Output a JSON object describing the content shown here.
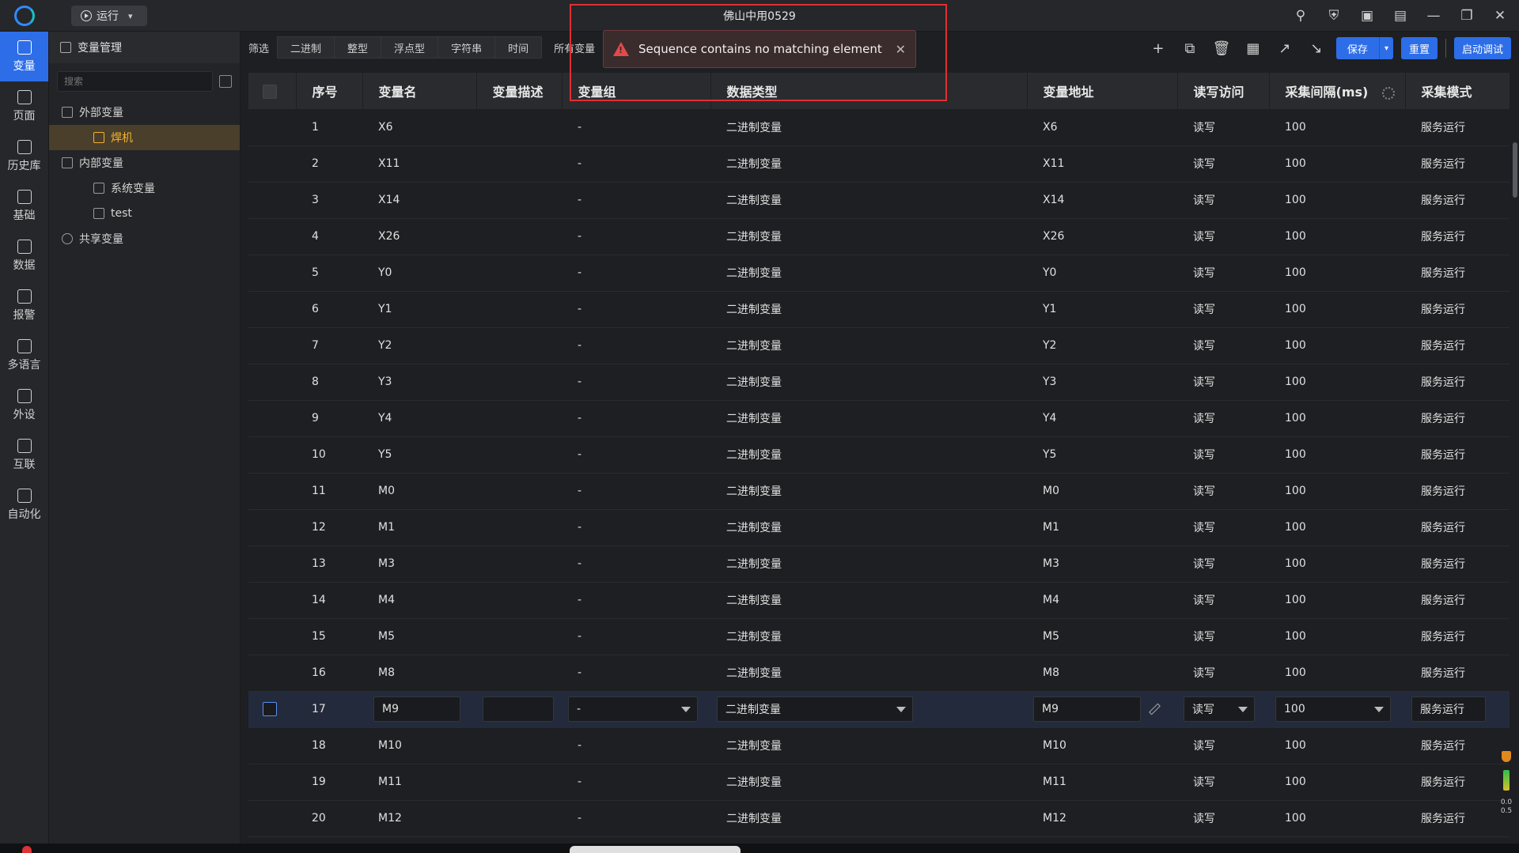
{
  "window": {
    "title": "佛山中用0529"
  },
  "topbar": {
    "run_label": "运行"
  },
  "rail": [
    {
      "label": "变量",
      "active": true
    },
    {
      "label": "页面"
    },
    {
      "label": "历史库"
    },
    {
      "label": "基础"
    },
    {
      "label": "数据"
    },
    {
      "label": "报警"
    },
    {
      "label": "多语言"
    },
    {
      "label": "外设"
    },
    {
      "label": "互联"
    },
    {
      "label": "自动化"
    }
  ],
  "tree": {
    "header": "变量管理",
    "search_placeholder": "搜索",
    "nodes": {
      "external": "外部变量",
      "welder": "焊机",
      "internal": "内部变量",
      "system": "系统变量",
      "test": "test",
      "shared": "共享变量"
    }
  },
  "filter": {
    "label": "筛选",
    "tabs": [
      "二进制",
      "整型",
      "浮点型",
      "字符串",
      "时间"
    ],
    "all": "所有变量"
  },
  "toolbar": {
    "save": "保存",
    "reset": "重置",
    "start_debug": "启动调试"
  },
  "toast": {
    "message": "Sequence contains no matching element"
  },
  "table": {
    "headers": [
      "序号",
      "变量名",
      "变量描述",
      "变量组",
      "数据类型",
      "变量地址",
      "读写访问",
      "采集间隔(ms)",
      "采集模式"
    ],
    "rows": [
      [
        "1",
        "X6",
        "",
        "-",
        "二进制变量",
        "X6",
        "读写",
        "100",
        "服务运行"
      ],
      [
        "2",
        "X11",
        "",
        "-",
        "二进制变量",
        "X11",
        "读写",
        "100",
        "服务运行"
      ],
      [
        "3",
        "X14",
        "",
        "-",
        "二进制变量",
        "X14",
        "读写",
        "100",
        "服务运行"
      ],
      [
        "4",
        "X26",
        "",
        "-",
        "二进制变量",
        "X26",
        "读写",
        "100",
        "服务运行"
      ],
      [
        "5",
        "Y0",
        "",
        "-",
        "二进制变量",
        "Y0",
        "读写",
        "100",
        "服务运行"
      ],
      [
        "6",
        "Y1",
        "",
        "-",
        "二进制变量",
        "Y1",
        "读写",
        "100",
        "服务运行"
      ],
      [
        "7",
        "Y2",
        "",
        "-",
        "二进制变量",
        "Y2",
        "读写",
        "100",
        "服务运行"
      ],
      [
        "8",
        "Y3",
        "",
        "-",
        "二进制变量",
        "Y3",
        "读写",
        "100",
        "服务运行"
      ],
      [
        "9",
        "Y4",
        "",
        "-",
        "二进制变量",
        "Y4",
        "读写",
        "100",
        "服务运行"
      ],
      [
        "10",
        "Y5",
        "",
        "-",
        "二进制变量",
        "Y5",
        "读写",
        "100",
        "服务运行"
      ],
      [
        "11",
        "M0",
        "",
        "-",
        "二进制变量",
        "M0",
        "读写",
        "100",
        "服务运行"
      ],
      [
        "12",
        "M1",
        "",
        "-",
        "二进制变量",
        "M1",
        "读写",
        "100",
        "服务运行"
      ],
      [
        "13",
        "M3",
        "",
        "-",
        "二进制变量",
        "M3",
        "读写",
        "100",
        "服务运行"
      ],
      [
        "14",
        "M4",
        "",
        "-",
        "二进制变量",
        "M4",
        "读写",
        "100",
        "服务运行"
      ],
      [
        "15",
        "M5",
        "",
        "-",
        "二进制变量",
        "M5",
        "读写",
        "100",
        "服务运行"
      ],
      [
        "16",
        "M8",
        "",
        "-",
        "二进制变量",
        "M8",
        "读写",
        "100",
        "服务运行"
      ],
      [
        "17",
        "M9",
        "",
        "-",
        "二进制变量",
        "M9",
        "读写",
        "100",
        "服务运行"
      ],
      [
        "18",
        "M10",
        "",
        "-",
        "二进制变量",
        "M10",
        "读写",
        "100",
        "服务运行"
      ],
      [
        "19",
        "M11",
        "",
        "-",
        "二进制变量",
        "M11",
        "读写",
        "100",
        "服务运行"
      ],
      [
        "20",
        "M12",
        "",
        "-",
        "二进制变量",
        "M12",
        "读写",
        "100",
        "服务运行"
      ]
    ],
    "editing_row": 16
  },
  "tray": {
    "speed_up": "0.0",
    "speed_down": "0.5"
  },
  "colors": {
    "accent": "#2d6ee8",
    "selected": "#f3b233",
    "error": "#e24a4a"
  }
}
